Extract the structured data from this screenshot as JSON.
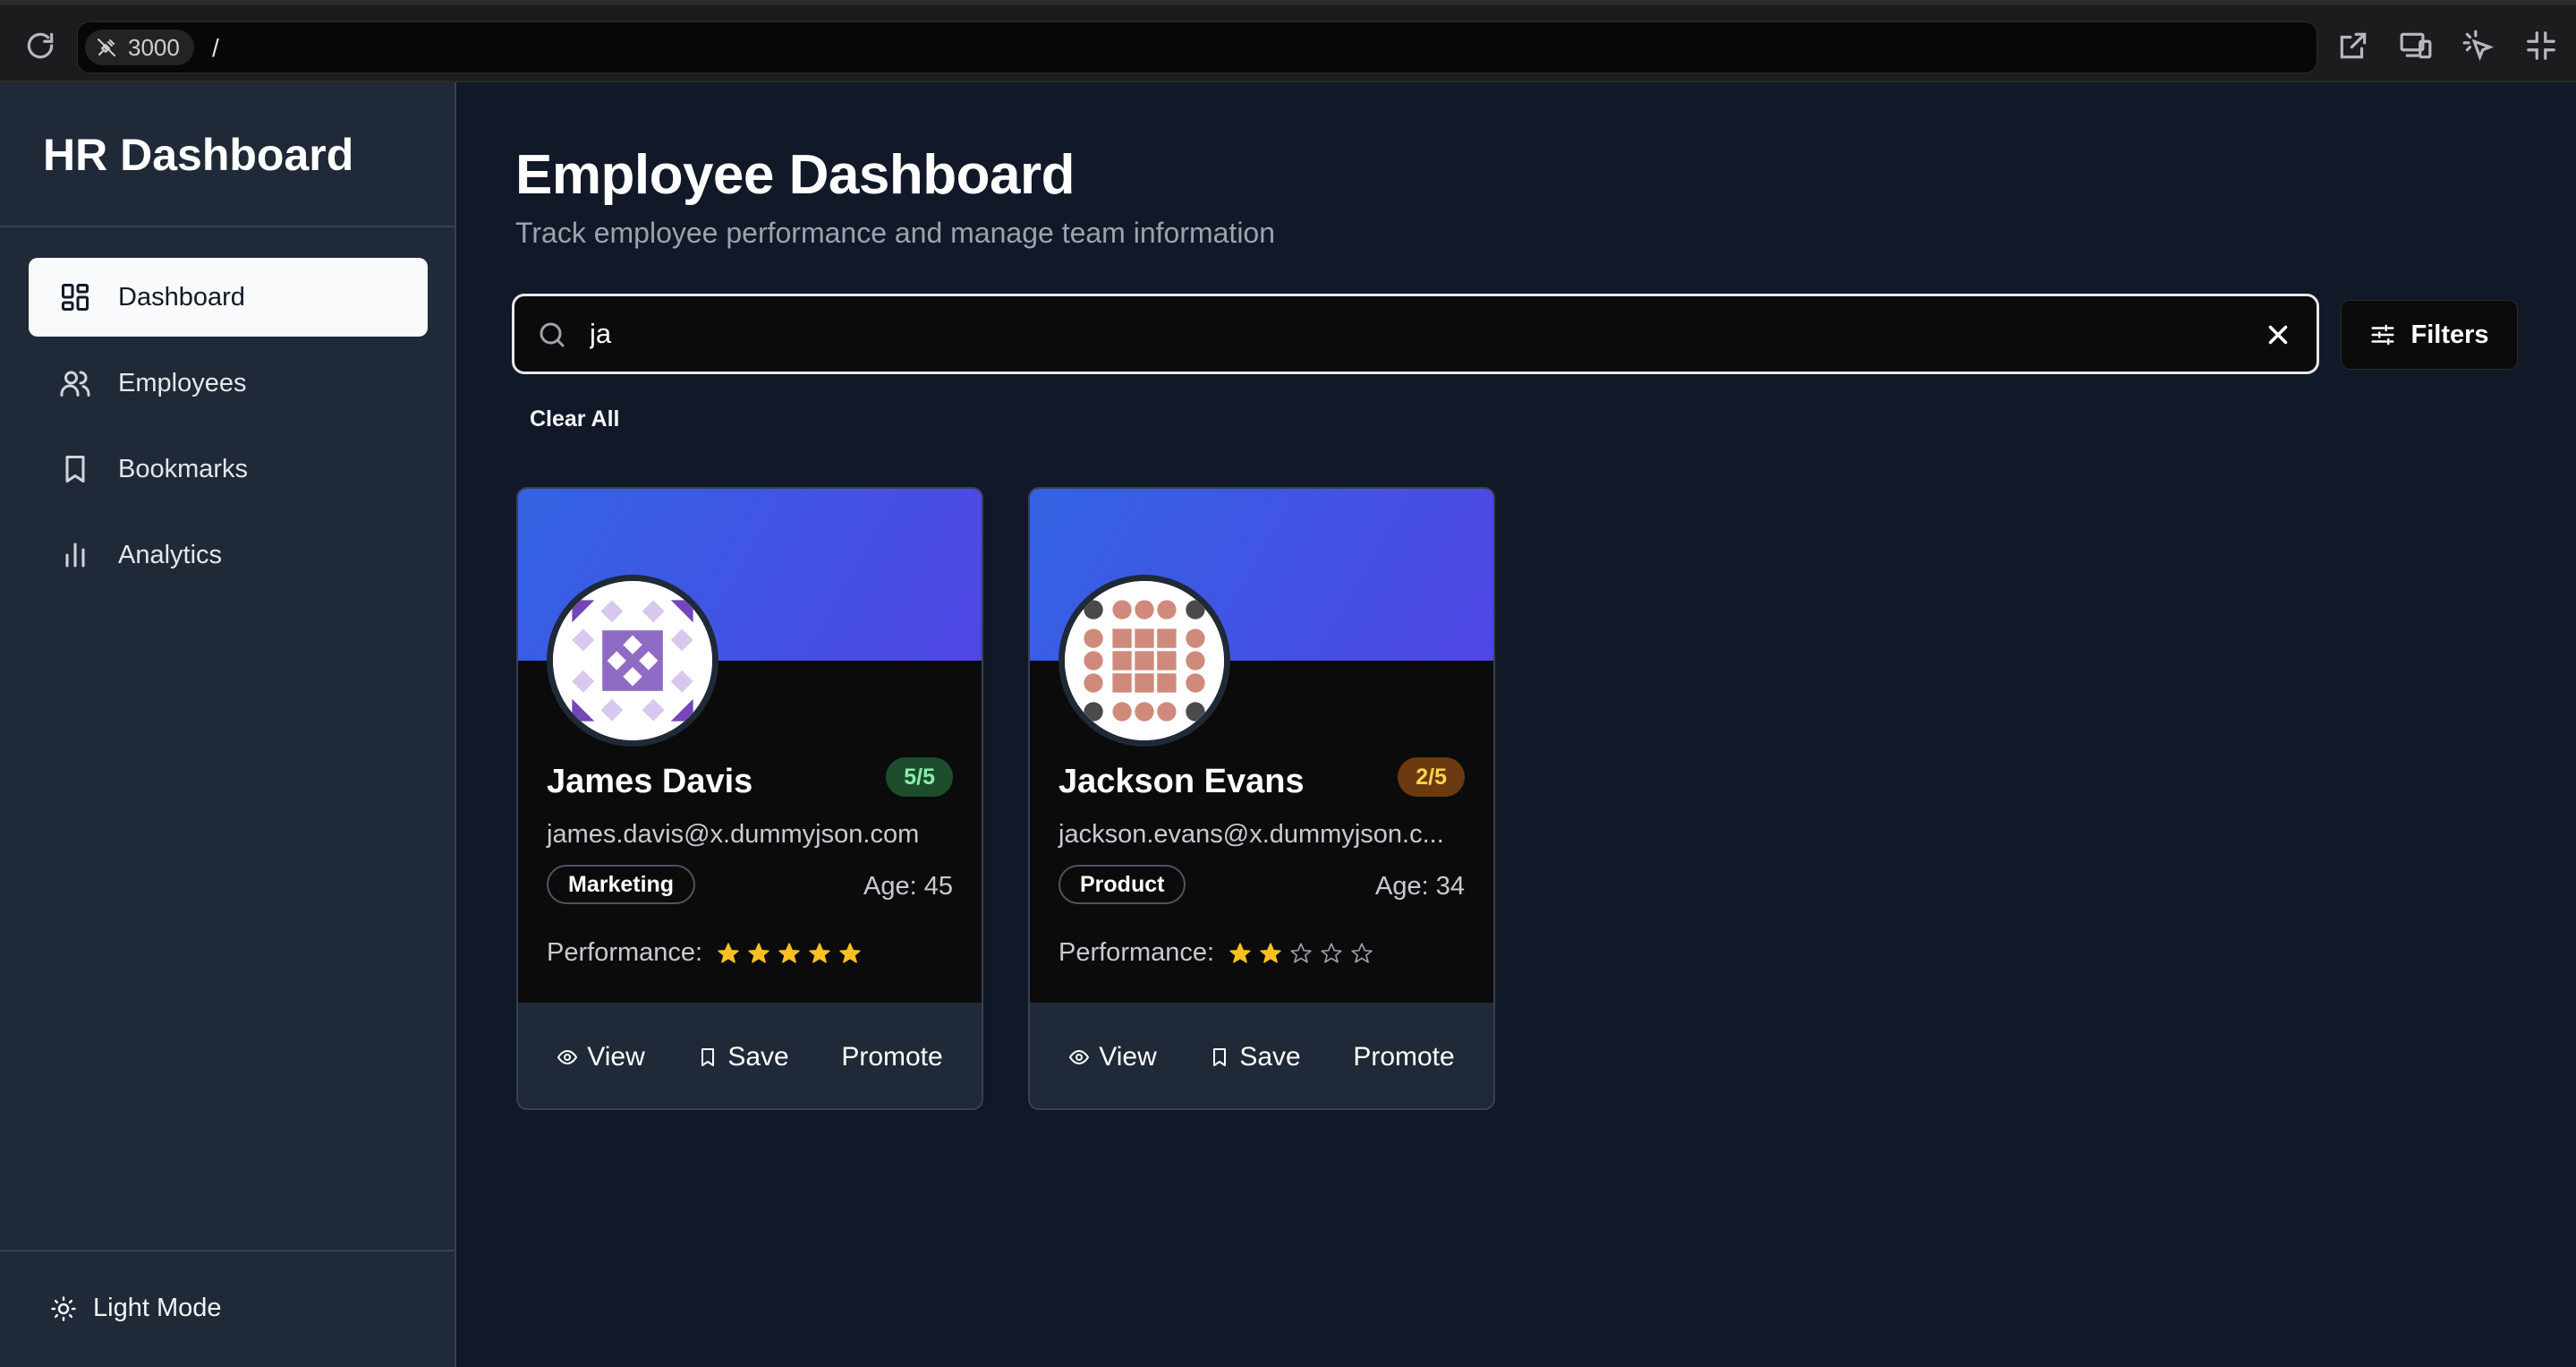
{
  "browser": {
    "port": "3000",
    "path": "/",
    "icons": [
      "reload-icon",
      "plug-icon",
      "external-link-icon",
      "devices-icon",
      "pointer-select-icon",
      "collapse-icon"
    ]
  },
  "sidebar": {
    "brand": "HR Dashboard",
    "items": [
      {
        "label": "Dashboard",
        "icon": "dashboard-grid-icon",
        "active": true
      },
      {
        "label": "Employees",
        "icon": "users-icon",
        "active": false
      },
      {
        "label": "Bookmarks",
        "icon": "bookmark-icon",
        "active": false
      },
      {
        "label": "Analytics",
        "icon": "bar-chart-icon",
        "active": false
      }
    ],
    "theme_toggle": "Light Mode"
  },
  "main": {
    "title": "Employee Dashboard",
    "subtitle": "Track employee performance and manage team information",
    "search": {
      "value": "ja",
      "placeholder": ""
    },
    "filters_label": "Filters",
    "clear_all": "Clear All"
  },
  "employees": [
    {
      "name": "James Davis",
      "email": "james.davis@x.dummyjson.com",
      "department": "Marketing",
      "age": "Age: 45",
      "rating_label": "5/5",
      "rating": 5,
      "performance_label": "Performance:",
      "actions": {
        "view": "View",
        "save": "Save",
        "promote": "Promote"
      }
    },
    {
      "name": "Jackson Evans",
      "email": "jackson.evans@x.dummyjson.c...",
      "department": "Product",
      "age": "Age: 34",
      "rating_label": "2/5",
      "rating": 2,
      "performance_label": "Performance:",
      "actions": {
        "view": "View",
        "save": "Save",
        "promote": "Promote"
      }
    }
  ],
  "colors": {
    "background": "#111827",
    "sidebar": "#1f2937",
    "banner_start": "#3363e3",
    "banner_end": "#4f46e5",
    "star": "#fbbf24",
    "badge_good": "#1e4d2b",
    "badge_low": "#6b3a10"
  }
}
